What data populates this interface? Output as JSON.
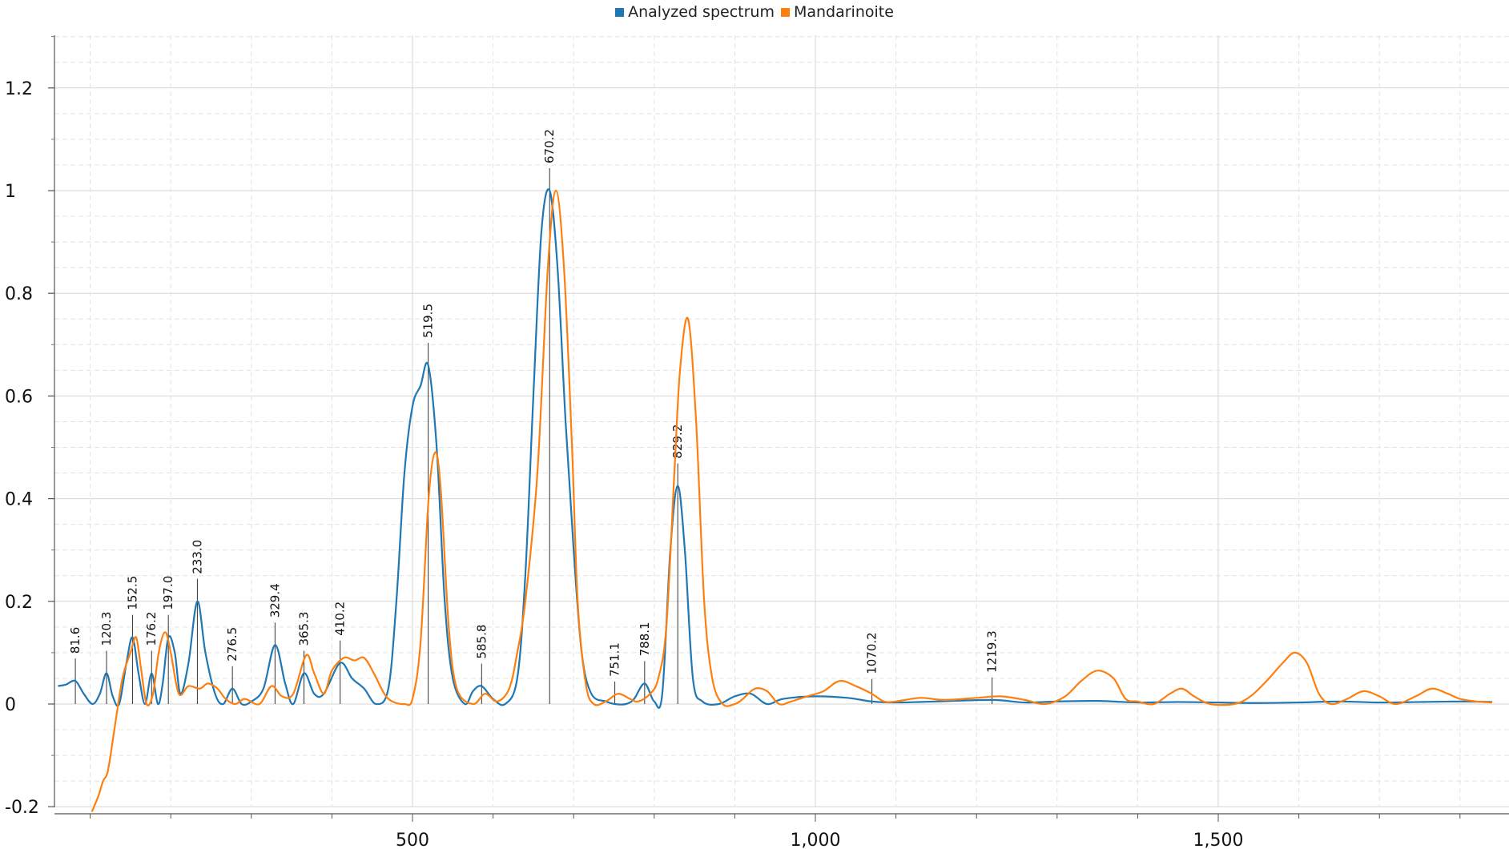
{
  "legend": [
    {
      "name": "Analyzed spectrum",
      "color": "#1f77b4"
    },
    {
      "name": "Mandarinoite",
      "color": "#ff7f0e"
    }
  ],
  "chart_data": {
    "type": "line",
    "title": "",
    "xlabel": "",
    "ylabel": "",
    "xlim": [
      40,
      1840
    ],
    "ylim": [
      -0.2,
      1.3
    ],
    "grid": true,
    "legend_position": "top-center",
    "x_ticks": [
      500,
      1000,
      1500
    ],
    "x_tick_labels": [
      "500",
      "1,000",
      "1,500"
    ],
    "y_ticks": [
      -0.2,
      0,
      0.2,
      0.4,
      0.6,
      0.8,
      1,
      1.2
    ],
    "y_tick_labels": [
      "-0.2",
      "0",
      "0.2",
      "0.4",
      "0.6",
      "0.8",
      "1",
      "1.2"
    ],
    "series": [
      {
        "name": "Analyzed spectrum",
        "color": "#1f77b4",
        "points": [
          [
            60,
            0.035
          ],
          [
            70,
            0.038
          ],
          [
            81.6,
            0.045
          ],
          [
            92,
            0.02
          ],
          [
            103,
            0.0
          ],
          [
            112,
            0.02
          ],
          [
            120.3,
            0.06
          ],
          [
            128,
            0.015
          ],
          [
            136,
            0.0
          ],
          [
            145,
            0.08
          ],
          [
            152.5,
            0.13
          ],
          [
            160,
            0.06
          ],
          [
            168,
            0.0
          ],
          [
            176.2,
            0.06
          ],
          [
            184,
            0.0
          ],
          [
            190,
            0.04
          ],
          [
            197,
            0.13
          ],
          [
            205,
            0.1
          ],
          [
            212,
            0.02
          ],
          [
            222,
            0.08
          ],
          [
            233,
            0.2
          ],
          [
            243,
            0.1
          ],
          [
            255,
            0.02
          ],
          [
            265,
            0.0
          ],
          [
            276.5,
            0.03
          ],
          [
            288,
            0.0
          ],
          [
            300,
            0.005
          ],
          [
            315,
            0.03
          ],
          [
            329.4,
            0.115
          ],
          [
            342,
            0.04
          ],
          [
            352,
            0.0
          ],
          [
            365.3,
            0.06
          ],
          [
            378,
            0.02
          ],
          [
            390,
            0.02
          ],
          [
            410.2,
            0.08
          ],
          [
            425,
            0.05
          ],
          [
            440,
            0.03
          ],
          [
            455,
            0.0
          ],
          [
            470,
            0.03
          ],
          [
            480,
            0.2
          ],
          [
            490,
            0.45
          ],
          [
            500,
            0.58
          ],
          [
            510,
            0.62
          ],
          [
            519.5,
            0.66
          ],
          [
            530,
            0.5
          ],
          [
            540,
            0.2
          ],
          [
            550,
            0.05
          ],
          [
            565,
            0.0
          ],
          [
            575,
            0.025
          ],
          [
            585.8,
            0.035
          ],
          [
            600,
            0.01
          ],
          [
            615,
            0.0
          ],
          [
            630,
            0.05
          ],
          [
            640,
            0.25
          ],
          [
            650,
            0.6
          ],
          [
            660,
            0.92
          ],
          [
            670.2,
            1.0
          ],
          [
            680,
            0.85
          ],
          [
            690,
            0.55
          ],
          [
            700,
            0.3
          ],
          [
            710,
            0.1
          ],
          [
            722,
            0.02
          ],
          [
            740,
            0.005
          ],
          [
            751.1,
            0.0
          ],
          [
            765,
            0.0
          ],
          [
            775,
            0.01
          ],
          [
            788.1,
            0.04
          ],
          [
            800,
            0.005
          ],
          [
            810,
            0.02
          ],
          [
            820,
            0.3
          ],
          [
            829.2,
            0.425
          ],
          [
            838,
            0.3
          ],
          [
            848,
            0.05
          ],
          [
            860,
            0.005
          ],
          [
            880,
            0.0
          ],
          [
            900,
            0.015
          ],
          [
            920,
            0.02
          ],
          [
            940,
            0.0
          ],
          [
            960,
            0.01
          ],
          [
            1000,
            0.015
          ],
          [
            1040,
            0.012
          ],
          [
            1070.2,
            0.005
          ],
          [
            1100,
            0.003
          ],
          [
            1150,
            0.005
          ],
          [
            1219.3,
            0.008
          ],
          [
            1260,
            0.003
          ],
          [
            1300,
            0.005
          ],
          [
            1350,
            0.006
          ],
          [
            1400,
            0.003
          ],
          [
            1450,
            0.004
          ],
          [
            1500,
            0.003
          ],
          [
            1550,
            0.002
          ],
          [
            1600,
            0.003
          ],
          [
            1650,
            0.005
          ],
          [
            1700,
            0.003
          ],
          [
            1750,
            0.004
          ],
          [
            1800,
            0.005
          ],
          [
            1840,
            0.004
          ]
        ]
      },
      {
        "name": "Mandarinoite",
        "color": "#ff7f0e",
        "points": [
          [
            102,
            -0.21
          ],
          [
            110,
            -0.18
          ],
          [
            116,
            -0.15
          ],
          [
            122,
            -0.13
          ],
          [
            130,
            -0.05
          ],
          [
            140,
            0.05
          ],
          [
            150,
            0.1
          ],
          [
            157,
            0.13
          ],
          [
            163,
            0.07
          ],
          [
            170,
            0.0
          ],
          [
            178,
            0.02
          ],
          [
            185,
            0.1
          ],
          [
            193,
            0.14
          ],
          [
            200,
            0.1
          ],
          [
            210,
            0.02
          ],
          [
            222,
            0.035
          ],
          [
            236,
            0.03
          ],
          [
            246,
            0.04
          ],
          [
            258,
            0.03
          ],
          [
            268,
            0.01
          ],
          [
            280,
            0.0
          ],
          [
            292,
            0.01
          ],
          [
            310,
            0.0
          ],
          [
            325,
            0.035
          ],
          [
            338,
            0.015
          ],
          [
            352,
            0.02
          ],
          [
            368,
            0.095
          ],
          [
            378,
            0.06
          ],
          [
            390,
            0.02
          ],
          [
            400,
            0.065
          ],
          [
            415,
            0.09
          ],
          [
            428,
            0.085
          ],
          [
            440,
            0.09
          ],
          [
            452,
            0.06
          ],
          [
            465,
            0.02
          ],
          [
            475,
            0.005
          ],
          [
            490,
            0.0
          ],
          [
            500,
            0.01
          ],
          [
            510,
            0.12
          ],
          [
            520,
            0.4
          ],
          [
            528,
            0.49
          ],
          [
            535,
            0.42
          ],
          [
            545,
            0.15
          ],
          [
            555,
            0.03
          ],
          [
            575,
            0.0
          ],
          [
            590,
            0.02
          ],
          [
            605,
            0.005
          ],
          [
            620,
            0.03
          ],
          [
            630,
            0.1
          ],
          [
            640,
            0.2
          ],
          [
            655,
            0.45
          ],
          [
            668,
            0.85
          ],
          [
            678,
            1.0
          ],
          [
            688,
            0.85
          ],
          [
            698,
            0.5
          ],
          [
            705,
            0.2
          ],
          [
            715,
            0.04
          ],
          [
            725,
            0.0
          ],
          [
            740,
            0.005
          ],
          [
            755,
            0.02
          ],
          [
            770,
            0.01
          ],
          [
            780,
            0.005
          ],
          [
            795,
            0.02
          ],
          [
            805,
            0.05
          ],
          [
            815,
            0.15
          ],
          [
            825,
            0.45
          ],
          [
            832,
            0.65
          ],
          [
            842,
            0.75
          ],
          [
            852,
            0.55
          ],
          [
            862,
            0.2
          ],
          [
            872,
            0.05
          ],
          [
            885,
            0.0
          ],
          [
            900,
            0.0
          ],
          [
            910,
            0.01
          ],
          [
            925,
            0.03
          ],
          [
            940,
            0.025
          ],
          [
            955,
            0.0
          ],
          [
            970,
            0.005
          ],
          [
            990,
            0.015
          ],
          [
            1010,
            0.025
          ],
          [
            1030,
            0.045
          ],
          [
            1050,
            0.035
          ],
          [
            1070,
            0.02
          ],
          [
            1085,
            0.005
          ],
          [
            1100,
            0.005
          ],
          [
            1130,
            0.012
          ],
          [
            1160,
            0.008
          ],
          [
            1200,
            0.012
          ],
          [
            1230,
            0.015
          ],
          [
            1260,
            0.008
          ],
          [
            1285,
            0.0
          ],
          [
            1310,
            0.015
          ],
          [
            1330,
            0.045
          ],
          [
            1350,
            0.065
          ],
          [
            1370,
            0.05
          ],
          [
            1385,
            0.01
          ],
          [
            1400,
            0.005
          ],
          [
            1420,
            0.0
          ],
          [
            1440,
            0.02
          ],
          [
            1455,
            0.03
          ],
          [
            1470,
            0.015
          ],
          [
            1490,
            0.0
          ],
          [
            1520,
            0.0
          ],
          [
            1540,
            0.015
          ],
          [
            1560,
            0.045
          ],
          [
            1580,
            0.08
          ],
          [
            1595,
            0.1
          ],
          [
            1610,
            0.08
          ],
          [
            1625,
            0.02
          ],
          [
            1640,
            0.0
          ],
          [
            1660,
            0.01
          ],
          [
            1680,
            0.025
          ],
          [
            1700,
            0.015
          ],
          [
            1720,
            0.0
          ],
          [
            1745,
            0.015
          ],
          [
            1765,
            0.03
          ],
          [
            1785,
            0.02
          ],
          [
            1800,
            0.01
          ],
          [
            1820,
            0.005
          ],
          [
            1840,
            0.003
          ]
        ]
      }
    ],
    "peaks": [
      {
        "x": 81.6,
        "label": "81.6",
        "y": 0.045
      },
      {
        "x": 120.3,
        "label": "120.3",
        "y": 0.06
      },
      {
        "x": 152.5,
        "label": "152.5",
        "y": 0.13
      },
      {
        "x": 176.2,
        "label": "176.2",
        "y": 0.06
      },
      {
        "x": 197.0,
        "label": "197.0",
        "y": 0.13
      },
      {
        "x": 233.0,
        "label": "233.0",
        "y": 0.2
      },
      {
        "x": 276.5,
        "label": "276.5",
        "y": 0.03
      },
      {
        "x": 329.4,
        "label": "329.4",
        "y": 0.115
      },
      {
        "x": 365.3,
        "label": "365.3",
        "y": 0.06
      },
      {
        "x": 410.2,
        "label": "410.2",
        "y": 0.08
      },
      {
        "x": 519.5,
        "label": "519.5",
        "y": 0.66
      },
      {
        "x": 585.8,
        "label": "585.8",
        "y": 0.035
      },
      {
        "x": 670.2,
        "label": "670.2",
        "y": 1.0
      },
      {
        "x": 751.1,
        "label": "751.1",
        "y": 0.0
      },
      {
        "x": 788.1,
        "label": "788.1",
        "y": 0.04
      },
      {
        "x": 829.2,
        "label": "829.2",
        "y": 0.425
      },
      {
        "x": 1070.2,
        "label": "1070.2",
        "y": 0.005
      },
      {
        "x": 1219.3,
        "label": "1219.3",
        "y": 0.008
      }
    ]
  }
}
